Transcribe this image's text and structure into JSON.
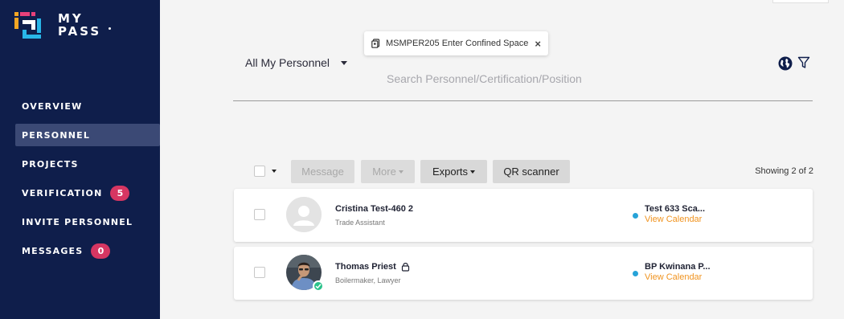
{
  "brand": {
    "line1": "MY",
    "line2": "PASS"
  },
  "sidebar": {
    "items": [
      {
        "label": "OVERVIEW",
        "badge": null,
        "active": false
      },
      {
        "label": "PERSONNEL",
        "badge": null,
        "active": true
      },
      {
        "label": "PROJECTS",
        "badge": null,
        "active": false
      },
      {
        "label": "VERIFICATION",
        "badge": "5",
        "active": false
      },
      {
        "label": "INVITE PERSONNEL",
        "badge": null,
        "active": false
      },
      {
        "label": "MESSAGES",
        "badge": "0",
        "active": false
      }
    ]
  },
  "filter_chip": {
    "label": "MSMPER205 Enter Confined Space",
    "close": "×"
  },
  "scope_select": {
    "value": "All My Personnel"
  },
  "search": {
    "placeholder": "Search Personnel/Certification/Position",
    "value": ""
  },
  "toolbar": {
    "message_label": "Message",
    "more_label": "More",
    "exports_label": "Exports",
    "qr_label": "QR scanner",
    "showing": "Showing 2 of 2"
  },
  "personnel": [
    {
      "name": "Cristina Test-460 2",
      "role": "Trade Assistant",
      "site": "Test 633 Sca...",
      "link": "View Calendar",
      "locked": false,
      "verified": false
    },
    {
      "name": "Thomas Priest",
      "role": "Boilermaker, Lawyer",
      "site": "BP Kwinana P...",
      "link": "View Calendar",
      "locked": true,
      "verified": true
    }
  ],
  "colors": {
    "sidebar": "#0f1e4b",
    "badge": "#d63662",
    "link": "#f0931f",
    "site_dot": "#27a3d8",
    "verified": "#2bc28b"
  }
}
